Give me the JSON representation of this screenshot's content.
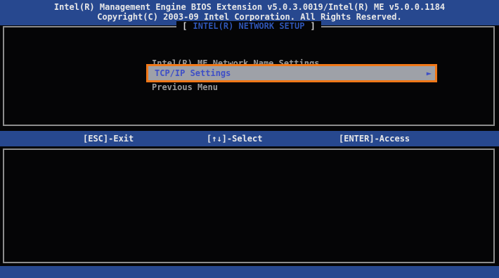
{
  "header": {
    "line1": "Intel(R) Management Engine BIOS Extension v5.0.3.0019/Intel(R) ME v5.0.0.1184",
    "line2": "Copyright(C) 2003-09 Intel Corporation.  All Rights Reserved."
  },
  "panel": {
    "title": "INTEL(R) NETWORK SETUP"
  },
  "menu": {
    "items": [
      {
        "label": "Intel(R) ME Network Name Settings"
      },
      {
        "label": "TCP/IP Settings",
        "selected": true,
        "arrow": "►"
      },
      {
        "label": "Previous Menu"
      }
    ]
  },
  "status_bar": {
    "exit": "[ESC]-Exit",
    "select": "[↑↓]-Select",
    "access": "[ENTER]-Access"
  },
  "colors": {
    "header_bg": "#27488f",
    "highlight_bg": "#9ea1a8",
    "highlight_text": "#3e4fc6",
    "callout_outline": "#f07818"
  }
}
